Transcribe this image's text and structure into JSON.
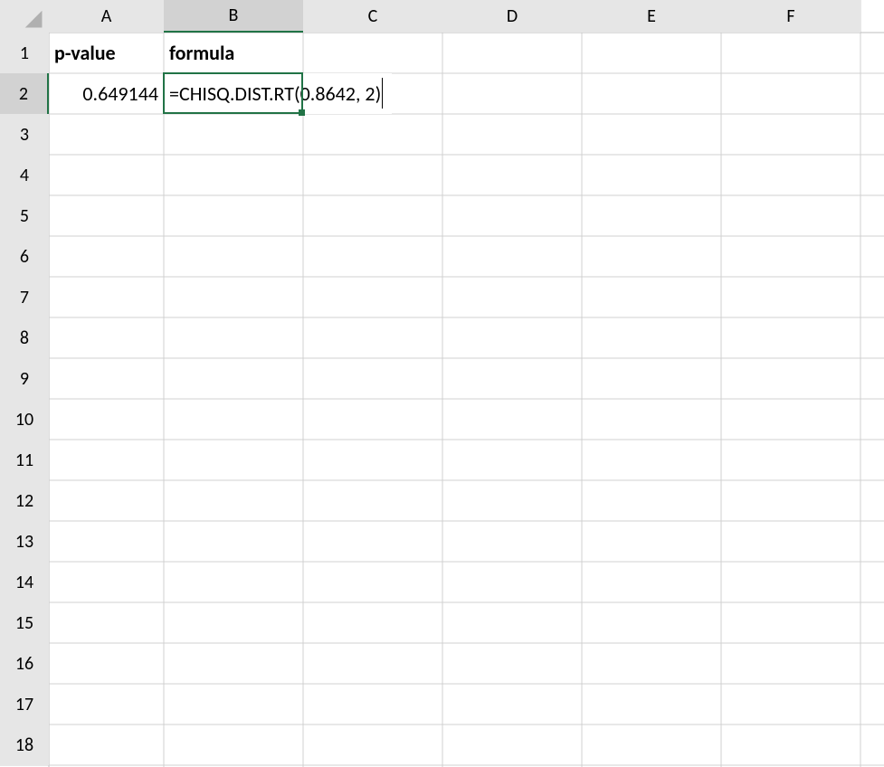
{
  "colors": {
    "accent": "#217346",
    "header_bg": "#e6e6e6",
    "grid": "#d0d0d0"
  },
  "columns": [
    "A",
    "B",
    "C",
    "D",
    "E",
    "F"
  ],
  "rows": [
    "1",
    "2",
    "3",
    "4",
    "5",
    "6",
    "7",
    "8",
    "9",
    "10",
    "11",
    "12",
    "13",
    "14",
    "15",
    "16",
    "17",
    "18"
  ],
  "headers": {
    "A1": "p-value",
    "B1": "formula"
  },
  "cells": {
    "A2": "0.649144",
    "B2": "=CHISQ.DIST.RT(0.8642, 2)"
  },
  "active_cell": "B2"
}
